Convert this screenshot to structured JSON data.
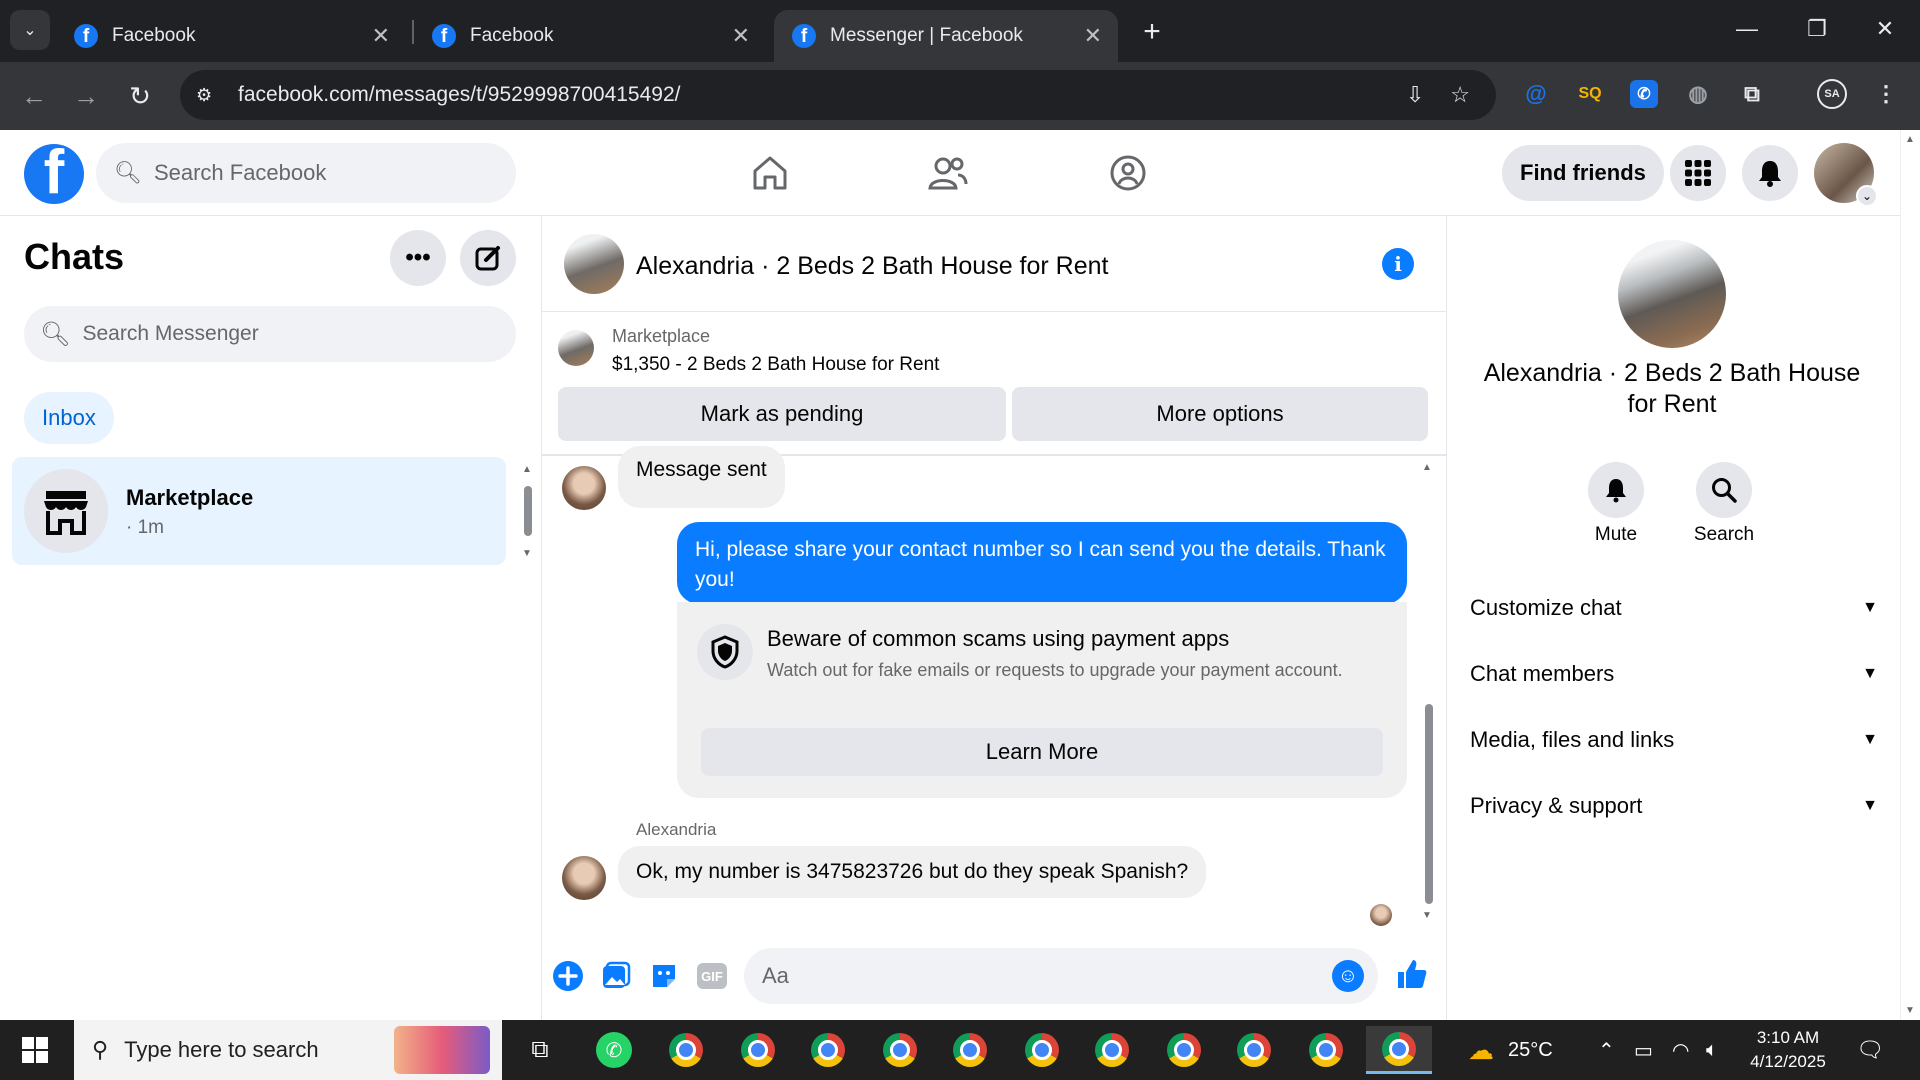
{
  "browser": {
    "tabs": [
      {
        "title": "Facebook",
        "active": false
      },
      {
        "title": "Facebook",
        "active": false
      },
      {
        "title": "Messenger | Facebook",
        "active": true
      }
    ],
    "url": "facebook.com/messages/t/9529998700415492/"
  },
  "fb_nav": {
    "search_placeholder": "Search Facebook",
    "find_friends": "Find friends"
  },
  "chats_panel": {
    "title": "Chats",
    "search_placeholder": "Search Messenger",
    "filter_inbox": "Inbox",
    "items": [
      {
        "name": "Marketplace",
        "time": "· 1m"
      }
    ]
  },
  "conversation": {
    "title": "Alexandria · 2 Beds 2 Bath House for Rent",
    "marketplace_label": "Marketplace",
    "listing": "$1,350 - 2 Beds 2 Bath House for Rent",
    "mark_pending": "Mark as pending",
    "more_options": "More options",
    "messages": {
      "msg1": "Message sent",
      "msg2": "Hi, please share your contact number so I can send you the details. Thank you!",
      "scam_title": "Beware of common scams using payment apps",
      "scam_body": "Watch out for fake emails or requests to upgrade your payment account.",
      "learn_more": "Learn More",
      "sender": "Alexandria",
      "msg3": "Ok, my number is 3475823726 but do they speak Spanish?"
    },
    "composer_placeholder": "Aa"
  },
  "info_panel": {
    "title": "Alexandria · 2 Beds 2 Bath House for Rent",
    "mute": "Mute",
    "search": "Search",
    "sections": [
      "Customize chat",
      "Chat members",
      "Media, files and links",
      "Privacy & support"
    ]
  },
  "taskbar": {
    "search_placeholder": "Type here to search",
    "temperature": "25°C",
    "time": "3:10 AM",
    "date": "4/12/2025"
  },
  "colors": {
    "fb_blue": "#1877f2",
    "messenger_blue": "#0a7cff",
    "chrome_dark": "#202124",
    "chrome_toolbar": "#35363a"
  }
}
